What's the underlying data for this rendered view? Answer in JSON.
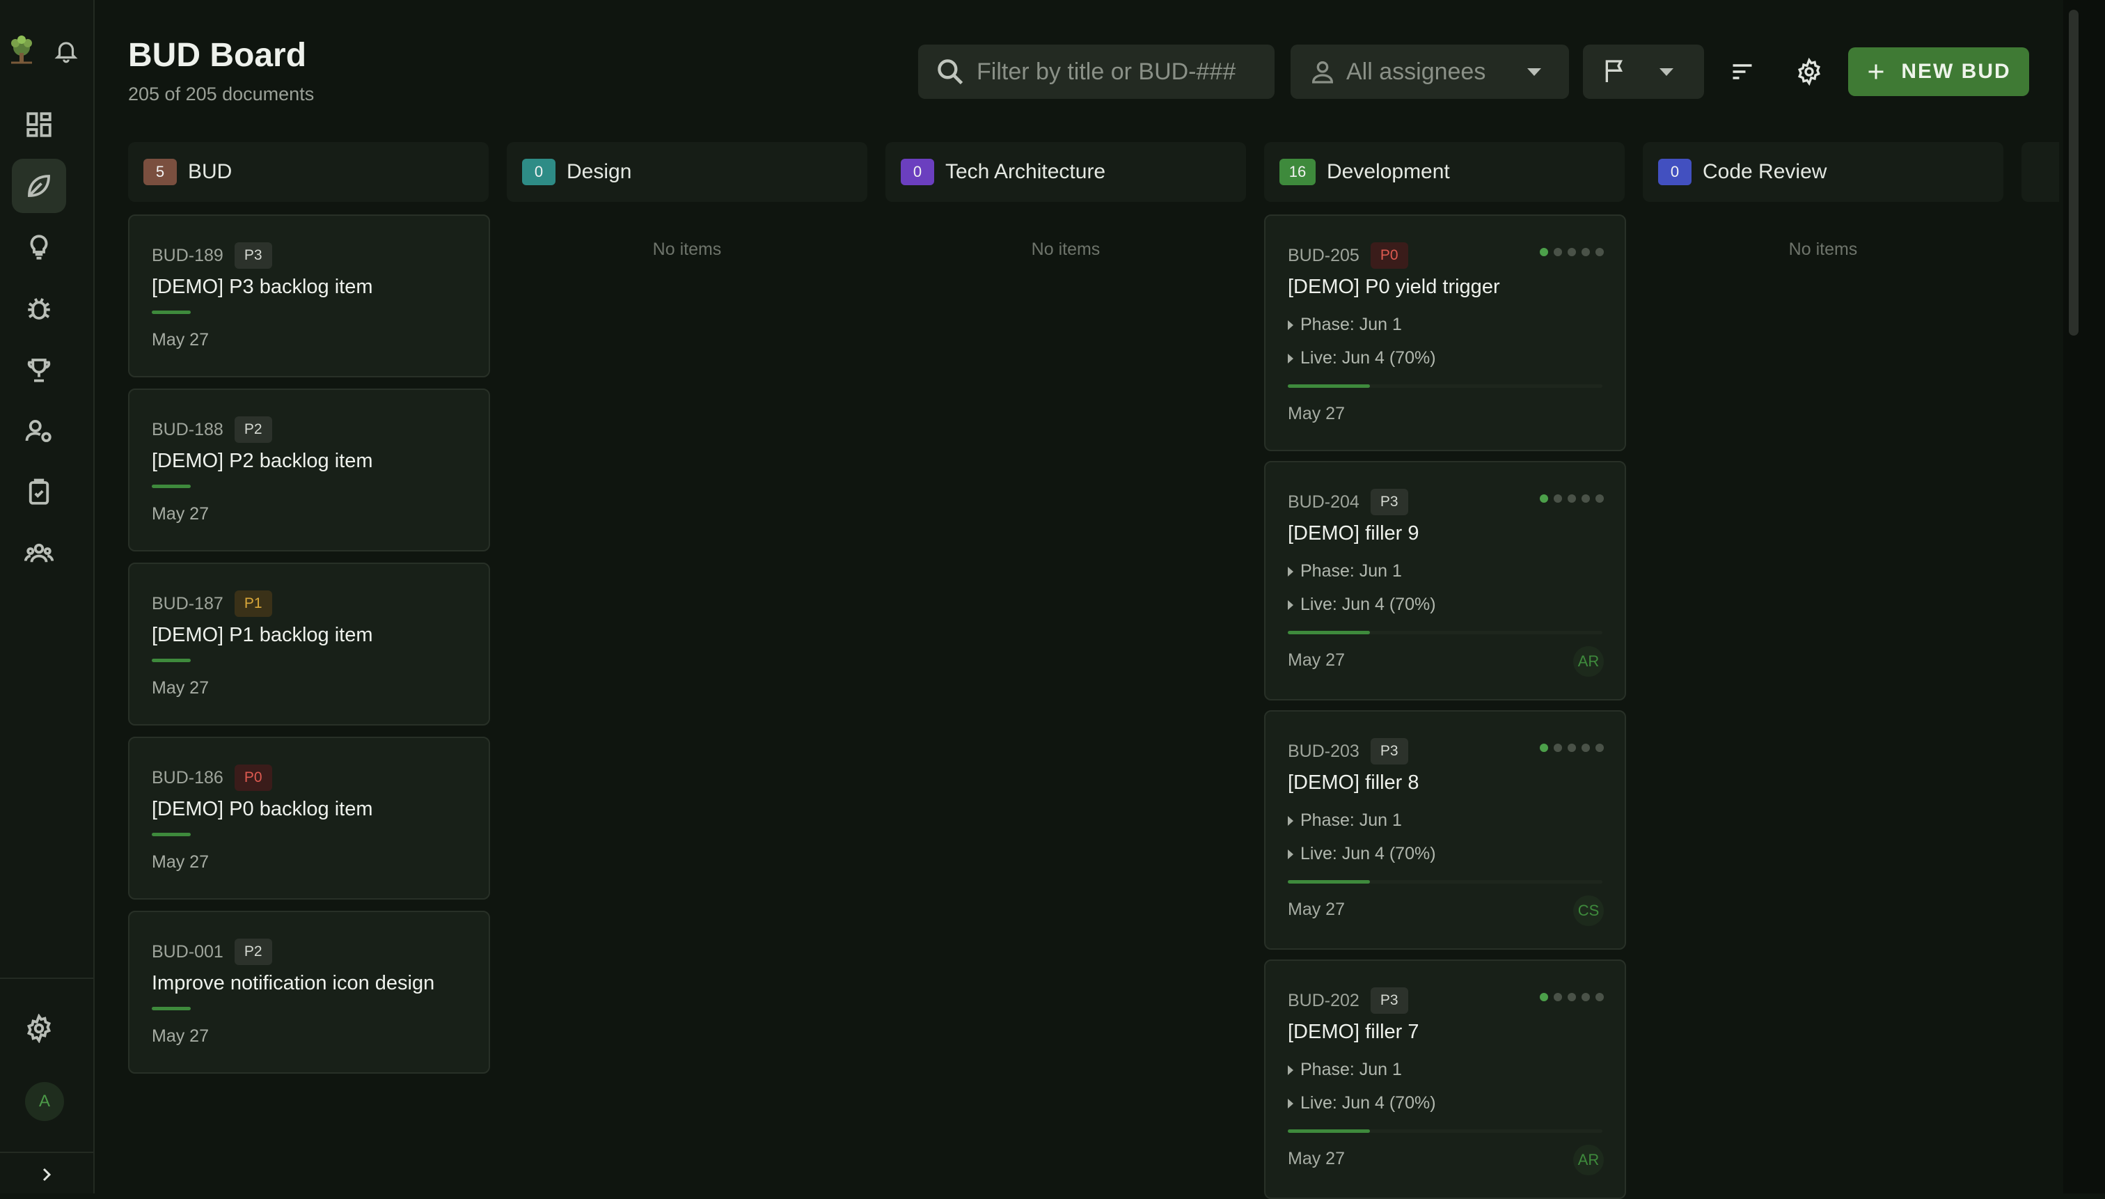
{
  "header": {
    "title": "BUD Board",
    "subtitle": "205 of 205 documents"
  },
  "toolbar": {
    "search_placeholder": "Filter by title or BUD-###",
    "assignee_label": "All assignees",
    "new_button_label": "NEW BUD"
  },
  "sidebar": {
    "avatar_initial": "A"
  },
  "columns": [
    {
      "name": "BUD",
      "count": "5",
      "color": "#7a4f3f"
    },
    {
      "name": "Design",
      "count": "0",
      "color": "#2e8c86"
    },
    {
      "name": "Tech Architecture",
      "count": "0",
      "color": "#6b3fbf"
    },
    {
      "name": "Development",
      "count": "16",
      "color": "#3e8a3c"
    },
    {
      "name": "Code Review",
      "count": "0",
      "color": "#4250c0"
    }
  ],
  "empty_label": "No items",
  "bud_cards": [
    {
      "id": "BUD-189",
      "priority": "P3",
      "title": "[DEMO] P3 backlog item",
      "date": "May 27"
    },
    {
      "id": "BUD-188",
      "priority": "P2",
      "title": "[DEMO] P2 backlog item",
      "date": "May 27"
    },
    {
      "id": "BUD-187",
      "priority": "P1",
      "title": "[DEMO] P1 backlog item",
      "date": "May 27"
    },
    {
      "id": "BUD-186",
      "priority": "P0",
      "title": "[DEMO] P0 backlog item",
      "date": "May 27"
    },
    {
      "id": "BUD-001",
      "priority": "P2",
      "title": "Improve notification icon design",
      "date": "May 27"
    }
  ],
  "dev_cards": [
    {
      "id": "BUD-205",
      "priority": "P0",
      "title": "[DEMO] P0 yield trigger",
      "phase": "Phase: Jun 1",
      "live": "Live: Jun 4 (70%)",
      "date": "May 27",
      "assignee": "",
      "progress": 0.26
    },
    {
      "id": "BUD-204",
      "priority": "P3",
      "title": "[DEMO] filler 9",
      "phase": "Phase: Jun 1",
      "live": "Live: Jun 4 (70%)",
      "date": "May 27",
      "assignee": "AR",
      "progress": 0.26
    },
    {
      "id": "BUD-203",
      "priority": "P3",
      "title": "[DEMO] filler 8",
      "phase": "Phase: Jun 1",
      "live": "Live: Jun 4 (70%)",
      "date": "May 27",
      "assignee": "CS",
      "progress": 0.26
    },
    {
      "id": "BUD-202",
      "priority": "P3",
      "title": "[DEMO] filler 7",
      "phase": "Phase: Jun 1",
      "live": "Live: Jun 4 (70%)",
      "date": "May 27",
      "assignee": "AR",
      "progress": 0.26
    }
  ]
}
